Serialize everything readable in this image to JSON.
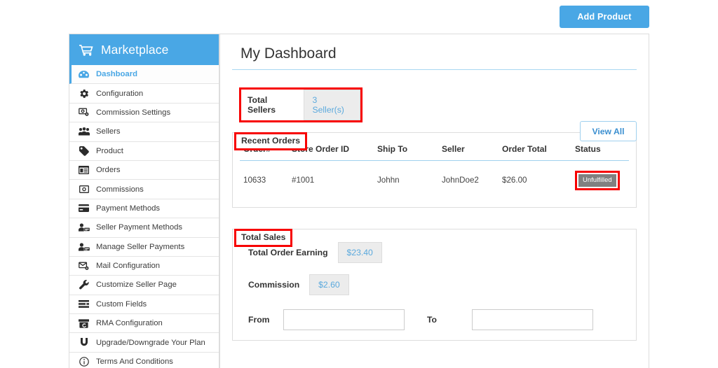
{
  "topbar": {
    "add_product_label": "Add Product"
  },
  "sidebar": {
    "brand": "Marketplace",
    "brand_icon": "shopping-cart-icon",
    "items": [
      {
        "label": "Dashboard",
        "icon": "dashboard-icon",
        "active": true
      },
      {
        "label": "Configuration",
        "icon": "gear-icon",
        "active": false
      },
      {
        "label": "Commission Settings",
        "icon": "money-gear-icon",
        "active": false
      },
      {
        "label": "Sellers",
        "icon": "users-icon",
        "active": false
      },
      {
        "label": "Product",
        "icon": "tag-icon",
        "active": false
      },
      {
        "label": "Orders",
        "icon": "list-box-icon",
        "active": false
      },
      {
        "label": "Commissions",
        "icon": "money-icon",
        "active": false
      },
      {
        "label": "Payment Methods",
        "icon": "credit-card-icon",
        "active": false
      },
      {
        "label": "Seller Payment Methods",
        "icon": "user-card-icon",
        "active": false
      },
      {
        "label": "Manage Seller Payments",
        "icon": "user-card-icon",
        "active": false
      },
      {
        "label": "Mail Configuration",
        "icon": "mail-gear-icon",
        "active": false
      },
      {
        "label": "Customize Seller Page",
        "icon": "wrench-icon",
        "active": false
      },
      {
        "label": "Custom Fields",
        "icon": "rows-icon",
        "active": false
      },
      {
        "label": "RMA Configuration",
        "icon": "package-return-icon",
        "active": false
      },
      {
        "label": "Upgrade/Downgrade Your Plan",
        "icon": "upgrade-icon",
        "active": false
      },
      {
        "label": "Terms And Conditions",
        "icon": "info-circle-icon",
        "active": false
      }
    ]
  },
  "main": {
    "page_title": "My Dashboard",
    "total_sellers": {
      "label": "Total Sellers",
      "value": "3 Seller(s)"
    },
    "recent_orders": {
      "section_label": "Recent Orders",
      "view_all_label": "View All",
      "columns": [
        "Order#",
        "Store Order ID",
        "Ship To",
        "Seller",
        "Order Total",
        "Status"
      ],
      "rows": [
        {
          "order_number": "10633",
          "store_order_id": "#1001",
          "ship_to": "Johhn",
          "seller": "JohnDoe2",
          "order_total": "$26.00",
          "status": "Unfulfilled"
        }
      ]
    },
    "total_sales": {
      "section_label": "Total Sales",
      "total_order_earning_label": "Total Order Earning",
      "total_order_earning_value": "$23.40",
      "commission_label": "Commission",
      "commission_value": "$2.60",
      "from_label": "From",
      "from_value": "",
      "from_placeholder": "",
      "to_label": "To",
      "to_value": "",
      "to_placeholder": ""
    }
  },
  "colors": {
    "brand_blue": "#49a7e5",
    "highlight_red": "#f70000",
    "status_gray": "#808080",
    "pill_bg": "#ececec",
    "pill_text": "#5aa9dd"
  }
}
